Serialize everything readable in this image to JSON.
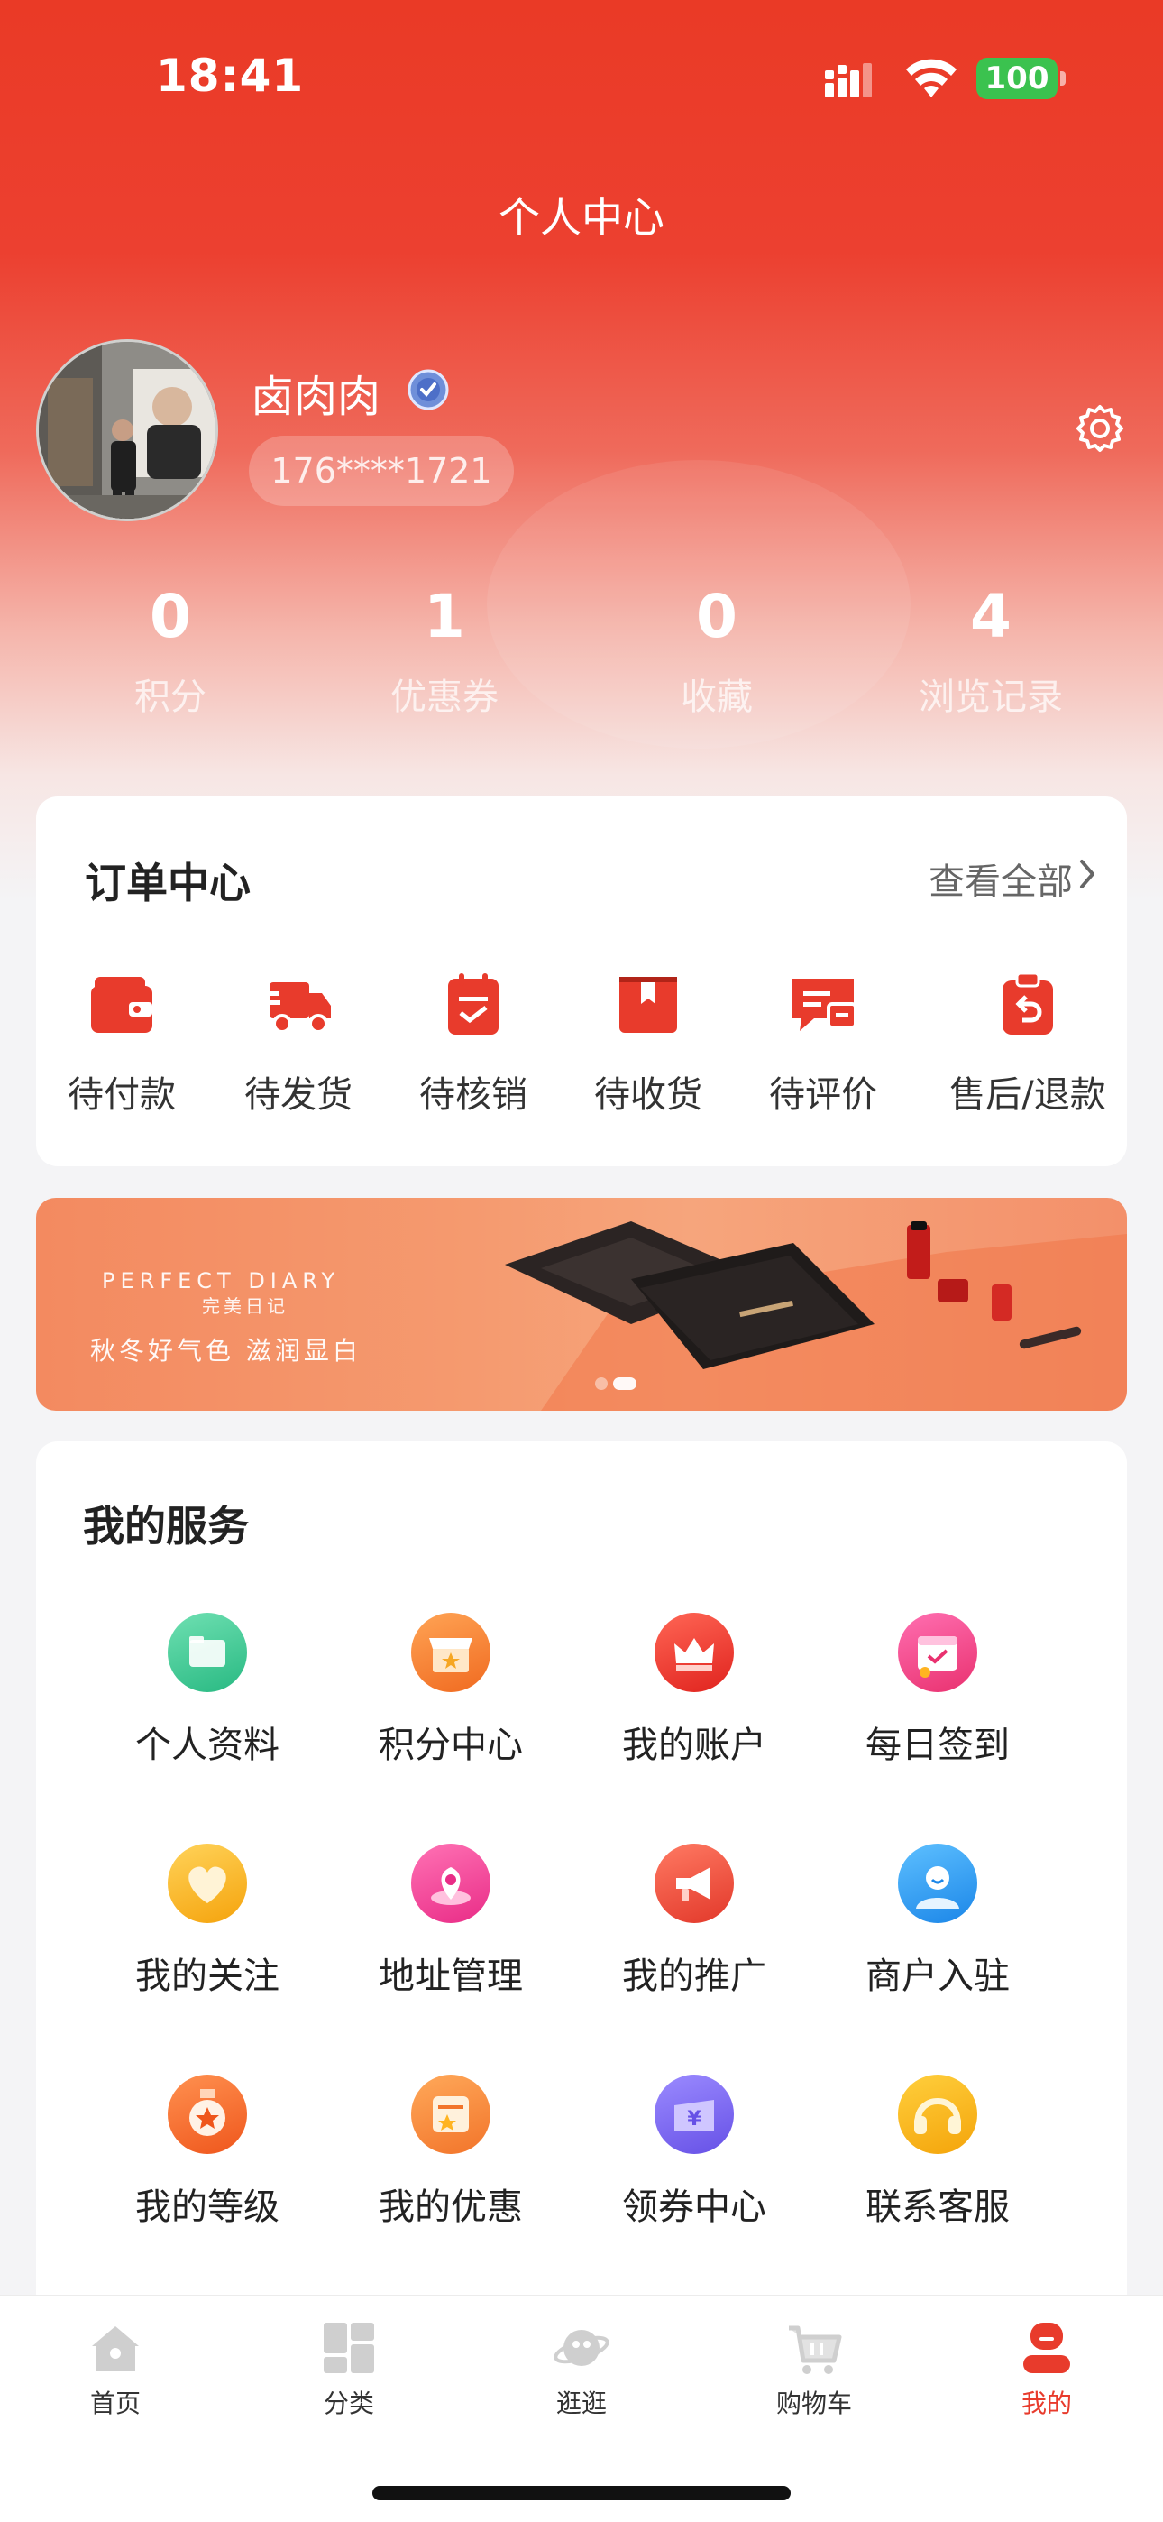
{
  "status_bar": {
    "time": "18:41",
    "battery": "100"
  },
  "page_title": "个人中心",
  "profile": {
    "username": "卤肉肉",
    "phone": "176****1721"
  },
  "stats": [
    {
      "value": "0",
      "label": "积分"
    },
    {
      "value": "1",
      "label": "优惠券"
    },
    {
      "value": "0",
      "label": "收藏"
    },
    {
      "value": "4",
      "label": "浏览记录"
    }
  ],
  "orders": {
    "title": "订单中心",
    "view_all": "查看全部",
    "items": [
      {
        "label": "待付款",
        "icon": "wallet-icon"
      },
      {
        "label": "待发货",
        "icon": "truck-icon"
      },
      {
        "label": "待核销",
        "icon": "clipboard-check-icon"
      },
      {
        "label": "待收货",
        "icon": "package-icon"
      },
      {
        "label": "待评价",
        "icon": "comment-icon"
      },
      {
        "label": "售后/退款",
        "icon": "refund-icon"
      }
    ]
  },
  "banner": {
    "brand": "PERFECT DIARY",
    "brand_cn": "完美日记",
    "slogan": "秋冬好气色 滋润显白"
  },
  "services": {
    "title": "我的服务",
    "items": [
      {
        "label": "个人资料",
        "icon": "folder-icon",
        "color": "#33c58e"
      },
      {
        "label": "积分中心",
        "icon": "store-icon",
        "color": "#f58634"
      },
      {
        "label": "我的账户",
        "icon": "crown-icon",
        "color": "#ee3b35"
      },
      {
        "label": "每日签到",
        "icon": "calendar-icon",
        "color": "#f23e8a"
      },
      {
        "label": "我的关注",
        "icon": "heart-icon",
        "color": "#f9b21e"
      },
      {
        "label": "地址管理",
        "icon": "location-icon",
        "color": "#f2449a"
      },
      {
        "label": "我的推广",
        "icon": "megaphone-icon",
        "color": "#ef4b3b"
      },
      {
        "label": "商户入驻",
        "icon": "merchant-icon",
        "color": "#2b9cf0"
      },
      {
        "label": "我的等级",
        "icon": "medal-icon",
        "color": "#f26d2b"
      },
      {
        "label": "我的优惠",
        "icon": "coupon-icon",
        "color": "#f58634"
      },
      {
        "label": "领券中心",
        "icon": "voucher-icon",
        "color": "#7a6cf0"
      },
      {
        "label": "联系客服",
        "icon": "headset-icon",
        "color": "#f7b21a"
      }
    ]
  },
  "tabbar": [
    {
      "label": "首页",
      "icon": "home-icon"
    },
    {
      "label": "分类",
      "icon": "category-icon"
    },
    {
      "label": "逛逛",
      "icon": "planet-icon"
    },
    {
      "label": "购物车",
      "icon": "cart-icon"
    },
    {
      "label": "我的",
      "icon": "profile-icon",
      "active": true
    }
  ],
  "colors": {
    "primary": "#e83b2c",
    "order_icon": "#e83b2c",
    "tab_inactive": "#c9c9c9"
  }
}
